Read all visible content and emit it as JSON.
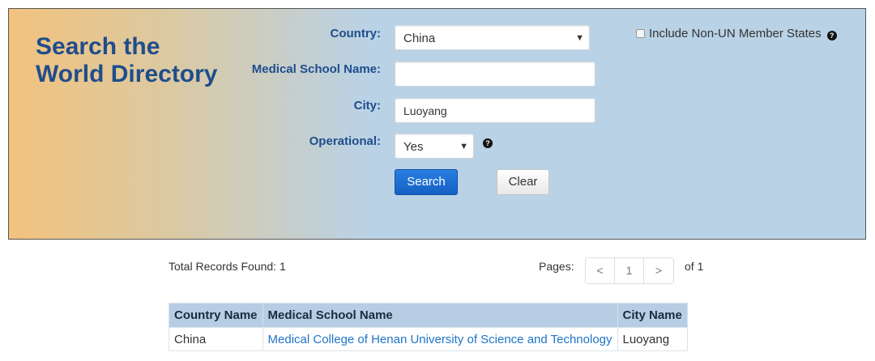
{
  "panel": {
    "title_line1": "Search the",
    "title_line2": "World Directory"
  },
  "form": {
    "country_label": "Country:",
    "country_value": "China",
    "school_label": "Medical School Name:",
    "school_value": "",
    "city_label": "City:",
    "city_value": "Luoyang",
    "operational_label": "Operational:",
    "operational_value": "Yes",
    "help_glyph": "?",
    "non_un_label": "Include Non-UN Member States",
    "search_button": "Search",
    "clear_button": "Clear"
  },
  "results": {
    "total_text": "Total Records Found: 1",
    "pages_label": "Pages:",
    "prev": "<",
    "current_page": "1",
    "next": ">",
    "of_text": "of 1",
    "columns": [
      "Country Name",
      "Medical School Name",
      "City Name"
    ],
    "rows": [
      [
        "China",
        "Medical College of Henan University of Science and Technology",
        "Luoyang"
      ]
    ]
  },
  "colors": {
    "accent_blue": "#1f4d8c",
    "panel_left": "#f2c27e",
    "panel_right": "#b9d2e6",
    "link": "#1f74c8"
  }
}
